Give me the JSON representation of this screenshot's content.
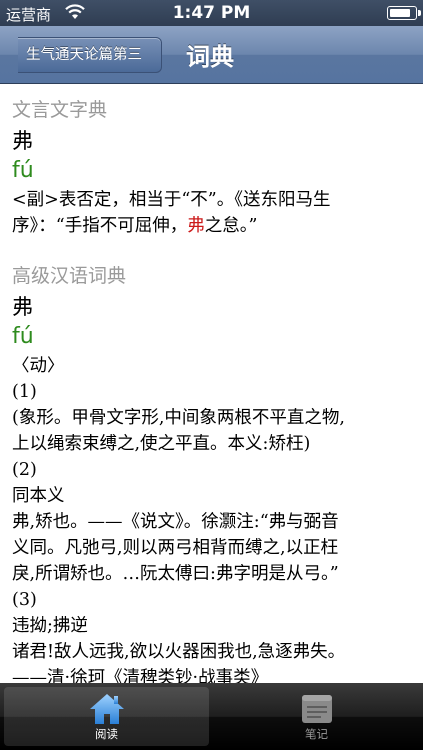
{
  "status": {
    "carrier": "运营商",
    "time": "1:47 PM",
    "battery_level": 0.85
  },
  "nav": {
    "back_label": "生气通天论篇第三",
    "title": "词典"
  },
  "entries": [
    {
      "title": "文言文字典",
      "headword": "弗",
      "pinyin": "fú",
      "lines": [
        "<副>表否定，相当于“不”。《送东阳马生",
        [
          "序》：“手指不可屈伸，",
          "弗",
          "之怠。”"
        ]
      ]
    },
    {
      "title": "高级汉语词典",
      "headword": "弗",
      "pinyin": "fú",
      "lines": [
        "〈动〉",
        "(1)",
        "(象形。甲骨文字形,中间象两根不平直之物,",
        "上以绳索束缚之,使之平直。本义:矫枉)",
        "(2)",
        "同本义",
        "弗,矫也。——《说文》。徐灏注:“弗与弼音",
        "义同。凡弛弓,则以两弓相背而缚之,以正枉",
        "戾,所谓矫也。…阮太傅曰:弗字明是从弓。”",
        "(3)",
        "违拗;拂逆",
        "诸君!敌人远我,欲以火器困我也,急逐弗失。",
        "——清·徐珂《清稗类钞·战事类》"
      ]
    }
  ],
  "tabs": [
    {
      "label": "阅读",
      "icon": "house-icon",
      "selected": true
    },
    {
      "label": "笔记",
      "icon": "notepad-icon",
      "selected": false
    }
  ],
  "colors": {
    "section_title": "#9a9a9a",
    "pinyin": "#2e8b1e",
    "highlight": "#cc1a1a",
    "nav_bar": "#6c86ad"
  }
}
